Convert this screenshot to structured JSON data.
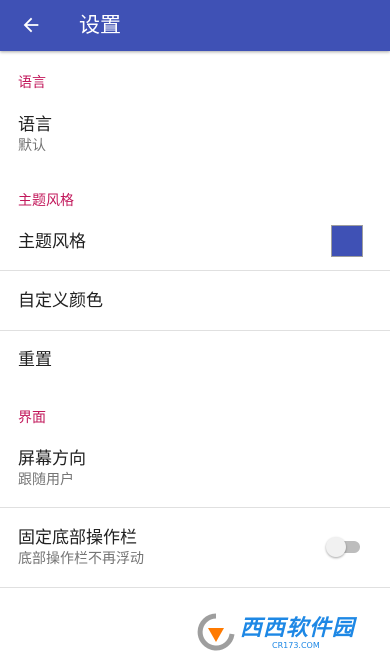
{
  "appbar": {
    "title": "设置",
    "back_icon": "arrow-back-icon",
    "color": "#3f51b5"
  },
  "sections": {
    "language": {
      "header": "语言",
      "item": {
        "title": "语言",
        "summary": "默认"
      }
    },
    "theme": {
      "header": "主题风格",
      "theme_item": {
        "title": "主题风格",
        "swatch_color": "#3f51b5"
      },
      "custom_color_item": {
        "title": "自定义颜色"
      },
      "reset_item": {
        "title": "重置"
      }
    },
    "interface": {
      "header": "界面",
      "orientation_item": {
        "title": "屏幕方向",
        "summary": "跟随用户"
      },
      "fixed_toolbar_item": {
        "title": "固定底部操作栏",
        "summary": "底部操作栏不再浮动",
        "checked": false
      }
    }
  },
  "colors": {
    "section_header": "#c2185b",
    "divider": "#e0e0e0"
  },
  "watermark": {
    "text": "西西软件园",
    "sub": "CR173.COM"
  }
}
